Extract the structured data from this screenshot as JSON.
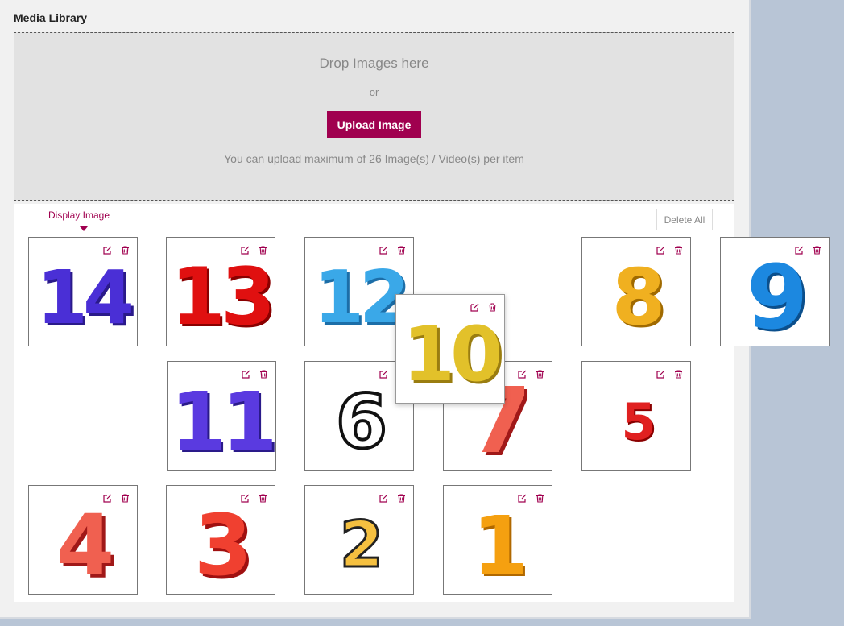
{
  "title": "Media Library",
  "dropzone": {
    "drop_text": "Drop Images here",
    "or_text": "or",
    "upload_label": "Upload Image",
    "limit_text": "You can upload maximum of 26 Image(s) / Video(s) per item"
  },
  "gallery": {
    "display_label": "Display Image",
    "delete_all_label": "Delete All",
    "images": [
      {
        "id": "14",
        "label": "14"
      },
      {
        "id": "13",
        "label": "13"
      },
      {
        "id": "12",
        "label": "12"
      },
      {
        "id": "10",
        "label": "10",
        "dragging": true
      },
      {
        "id": "8",
        "label": "8"
      },
      {
        "id": "9",
        "label": "9"
      },
      {
        "id": "11",
        "label": "11"
      },
      {
        "id": "6",
        "label": "6"
      },
      {
        "id": "7",
        "label": "7"
      },
      {
        "id": "5",
        "label": "5"
      },
      {
        "id": "4",
        "label": "4"
      },
      {
        "id": "3",
        "label": "3"
      },
      {
        "id": "2",
        "label": "2"
      },
      {
        "id": "1",
        "label": "1"
      }
    ]
  },
  "colors": {
    "accent": "#a0004f",
    "background": "#b8c5d6"
  },
  "icons": {
    "edit": "edit-icon",
    "delete": "trash-icon"
  }
}
